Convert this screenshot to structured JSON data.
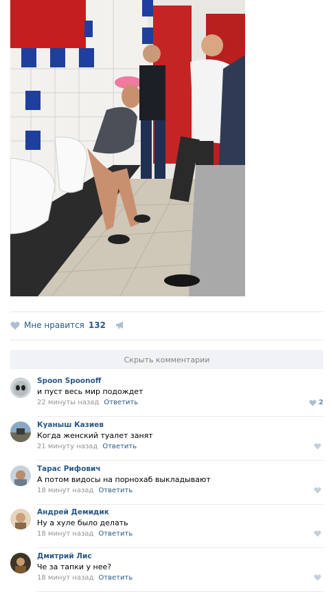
{
  "post": {
    "likes_label": "Мне нравится",
    "likes_count": "132",
    "hide_comments": "Скрыть комментарии"
  },
  "comments": [
    {
      "author": "Spoon Spoonoff",
      "text": "и пуст весь мир подождет",
      "time": "22 минуты назад",
      "reply": "Ответить",
      "likes": "2"
    },
    {
      "author": "Куаныш Казиев",
      "text": "Когда женский туалет занят",
      "time": "21 минуту назад",
      "reply": "Ответить",
      "likes": ""
    },
    {
      "author": "Тарас Рифович",
      "text": "А потом видосы на порнохаб выкладывают",
      "time": "18 минут назад",
      "reply": "Ответить",
      "likes": ""
    },
    {
      "author": "Андрей Демидик",
      "text": "Ну а хуле было делать",
      "time": "18 минут назад",
      "reply": "Ответить",
      "likes": ""
    },
    {
      "author": "Дмитрий Лис",
      "text": "Че за тапки у нее?",
      "time": "18 минут назад",
      "reply": "Ответить",
      "likes": ""
    }
  ],
  "colors": {
    "link": "#2a5885",
    "meta": "#939393",
    "divider": "#e7e8ec",
    "button_bg": "#f0f2f5"
  },
  "icons": {
    "like": "heart-icon",
    "share": "megaphone-icon"
  }
}
